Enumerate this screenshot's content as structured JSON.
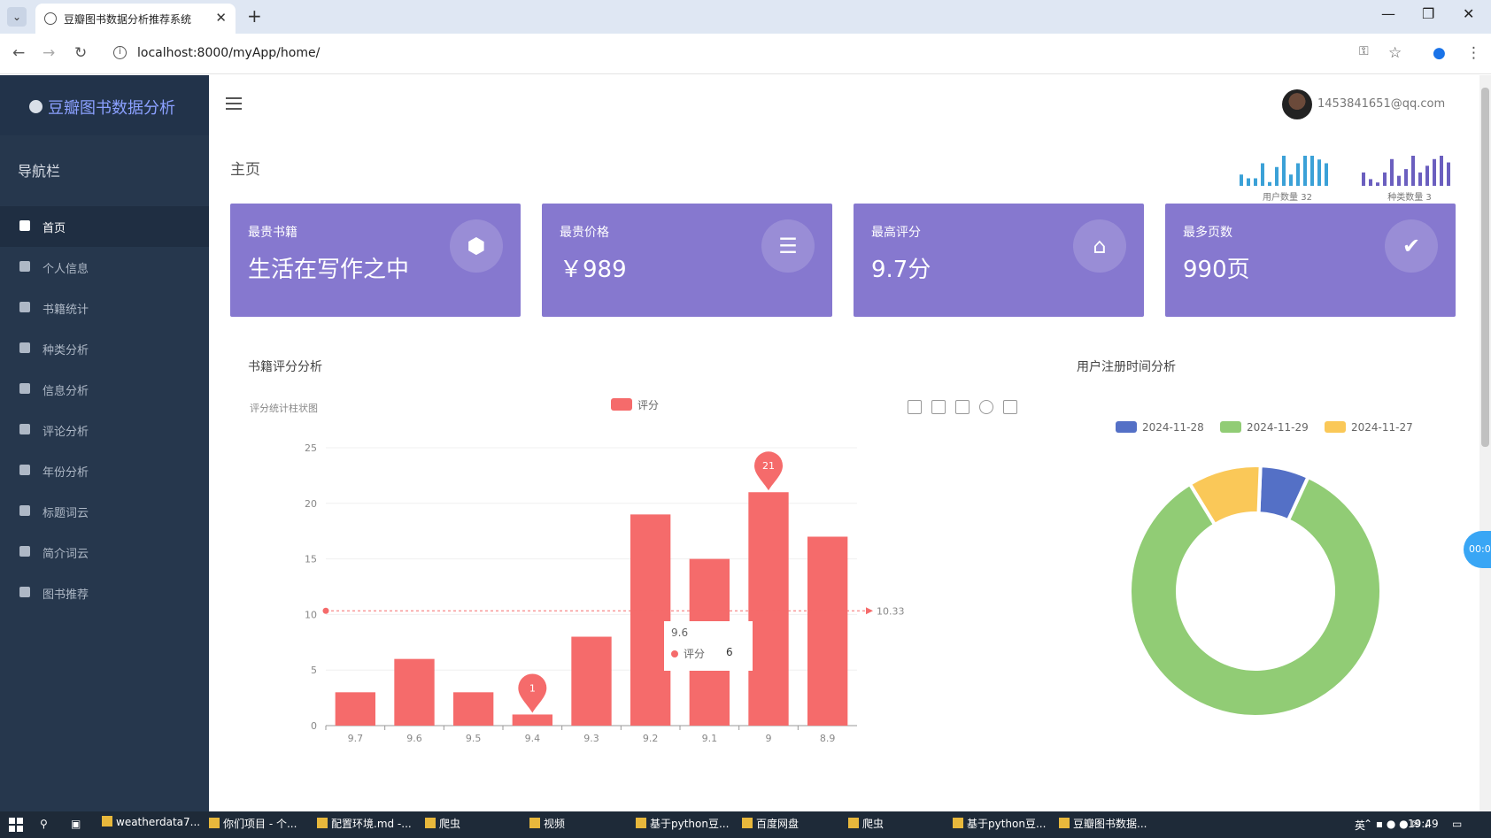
{
  "browser": {
    "tab_title": "豆瓣图书数据分析推荐系统",
    "url": "localhost:8000/myApp/home/"
  },
  "brand": {
    "name": "豆瓣图书数据分析"
  },
  "nav": {
    "title": "导航栏",
    "items": [
      {
        "label": "首页",
        "icon": "home-icon"
      },
      {
        "label": "个人信息",
        "icon": "user-icon"
      },
      {
        "label": "书籍统计",
        "icon": "calendar-icon"
      },
      {
        "label": "种类分析",
        "icon": "person-icon"
      },
      {
        "label": "信息分析",
        "icon": "file-icon"
      },
      {
        "label": "评论分析",
        "icon": "comment-icon"
      },
      {
        "label": "年份分析",
        "icon": "pie-icon"
      },
      {
        "label": "标题词云",
        "icon": "cloud-icon"
      },
      {
        "label": "简介词云",
        "icon": "cloud-icon"
      },
      {
        "label": "图书推荐",
        "icon": "square-icon"
      }
    ]
  },
  "header": {
    "email": "1453841651@qq.com"
  },
  "page": {
    "title": "主页"
  },
  "mini_stats": [
    {
      "label": "用户数量 32",
      "values": [
        3,
        2,
        2,
        6,
        1,
        5,
        8,
        3,
        6,
        8,
        8,
        7,
        6
      ],
      "color": "#3ba1d7"
    },
    {
      "label": "种类数量 3",
      "values": [
        4,
        2,
        1,
        4,
        8,
        3,
        5,
        9,
        4,
        6,
        8,
        9,
        7
      ],
      "color": "#6b5fbf"
    }
  ],
  "cards": [
    {
      "label": "最贵书籍",
      "value": "生活在写作之中",
      "icon": "cube-icon",
      "glyph": "⬢"
    },
    {
      "label": "最贵价格",
      "value": "￥989",
      "icon": "layers-icon",
      "glyph": "☰"
    },
    {
      "label": "最高评分",
      "value": "9.7分",
      "icon": "tag-icon",
      "glyph": "⌂"
    },
    {
      "label": "最多页数",
      "value": "990页",
      "icon": "bag-icon",
      "glyph": "✔"
    }
  ],
  "sections": {
    "rating": "书籍评分分析",
    "register": "用户注册时间分析"
  },
  "tooltip": {
    "header": "9.6",
    "series": "评分",
    "value": "6"
  },
  "chart_data": [
    {
      "type": "bar",
      "title": "书籍评分分析",
      "subtitle": "评分统计柱状图",
      "categories": [
        "9.7",
        "9.6",
        "9.5",
        "9.4",
        "9.3",
        "9.2",
        "9.1",
        "9",
        "8.9"
      ],
      "series": [
        {
          "name": "评分",
          "values": [
            3,
            6,
            3,
            1,
            8,
            19,
            15,
            21,
            17
          ],
          "color": "#f56b6b"
        }
      ],
      "ylim": [
        0,
        25
      ],
      "yticks": [
        0,
        5,
        10,
        15,
        20,
        25
      ],
      "markpoints": [
        {
          "type": "min",
          "label": "1"
        },
        {
          "type": "max",
          "label": "21"
        }
      ],
      "markline": {
        "type": "average",
        "value": 10.33,
        "label": "10.33"
      },
      "legend": "top"
    },
    {
      "type": "pie",
      "title": "用户注册时间分析",
      "categories": [
        "2024-11-28",
        "2024-11-29",
        "2024-11-27"
      ],
      "values": [
        2,
        27,
        3
      ],
      "colors": [
        "#5470c6",
        "#91cc75",
        "#fac858"
      ],
      "legend": "top"
    }
  ],
  "taskbar": {
    "items": [
      "weatherdata7...",
      "你们项目 - 个...",
      "配置环境.md -...",
      "爬虫",
      "视频",
      "基于python豆...",
      "百度网盘",
      "爬虫",
      "基于python豆...",
      "豆瓣图书数据..."
    ],
    "time": "19:49",
    "ime": "英"
  }
}
